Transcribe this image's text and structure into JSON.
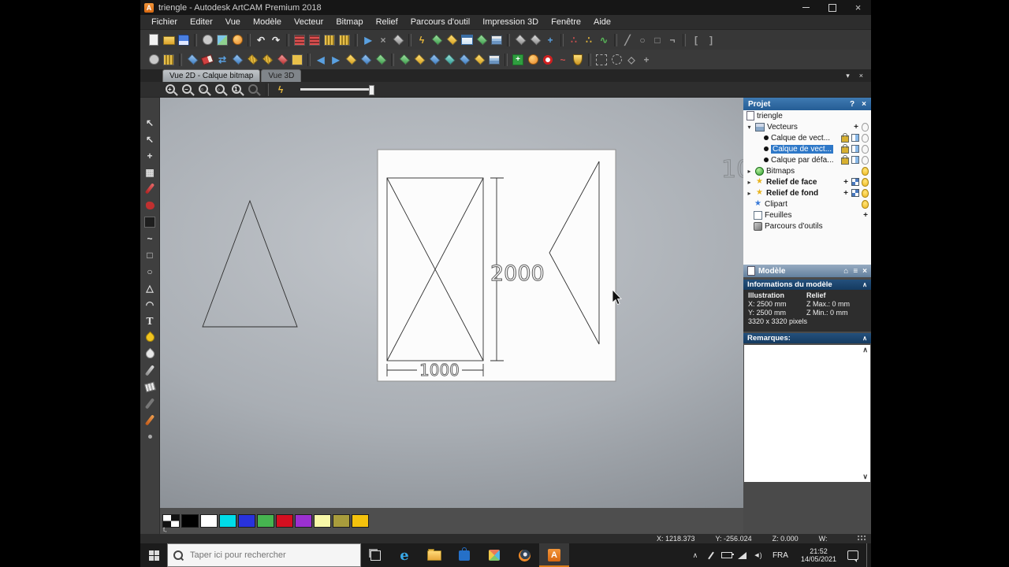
{
  "window": {
    "title": "triengle - Autodesk ArtCAM Premium 2018"
  },
  "menu": {
    "items": [
      "Fichier",
      "Editer",
      "Vue",
      "Modèle",
      "Vecteur",
      "Bitmap",
      "Relief",
      "Parcours d'outil",
      "Impression 3D",
      "Fenêtre",
      "Aide"
    ]
  },
  "tabs": {
    "view2d": "Vue 2D - Calque bitmap",
    "view3d": "Vue 3D"
  },
  "view_controls": {
    "menu": "▾",
    "close": "×"
  },
  "toolbar_main": [
    {
      "name": "new-model-icon",
      "cls": "pg"
    },
    {
      "name": "open-model-icon",
      "cls": "fld"
    },
    {
      "name": "save-model-icon",
      "cls": "flp"
    },
    {
      "sep": true
    },
    {
      "name": "render-preview-icon",
      "cls": "ci gray"
    },
    {
      "name": "bitmap-image-icon",
      "cls": "sq img"
    },
    {
      "name": "face-wizard-icon",
      "cls": "ci orange"
    },
    {
      "sep": true
    },
    {
      "name": "undo-icon",
      "cls": "gl cw",
      "glyph": "↶"
    },
    {
      "name": "redo-icon",
      "cls": "gl cw",
      "glyph": "↷"
    },
    {
      "sep": true
    },
    {
      "name": "guide-film-icon",
      "cls": "sq redstr"
    },
    {
      "name": "guide-film2-icon",
      "cls": "sq redstr"
    },
    {
      "name": "snap-grid-icon",
      "cls": "sq goldstr"
    },
    {
      "name": "snap-guides-icon",
      "cls": "sq goldstr"
    },
    {
      "sep": true
    },
    {
      "name": "vector-select-icon",
      "cls": "gl cbl",
      "glyph": "▶"
    },
    {
      "name": "trim-vectors-icon",
      "cls": "gl cgy",
      "glyph": "×"
    },
    {
      "name": "offset-vector-icon",
      "cls": "di gray"
    },
    {
      "sep": true
    },
    {
      "name": "quick-relief-icon",
      "cls": "gl cgo",
      "glyph": "ϟ"
    },
    {
      "name": "relief-green-icon",
      "cls": "di green"
    },
    {
      "name": "relief-gold-icon",
      "cls": "di gold"
    },
    {
      "name": "preview-window-icon",
      "cls": "win"
    },
    {
      "name": "relief-green2-icon",
      "cls": "di green"
    },
    {
      "name": "relief-layers-icon",
      "cls": "layers"
    },
    {
      "sep": true
    },
    {
      "name": "relief-gray-icon",
      "cls": "di gray"
    },
    {
      "name": "relief-gray2-icon",
      "cls": "di gray"
    },
    {
      "name": "add-relief-icon",
      "cls": "gl cbl",
      "glyph": "+"
    },
    {
      "sep": true
    },
    {
      "name": "node-points-icon",
      "cls": "gl cr",
      "glyph": "∴"
    },
    {
      "name": "node-points2-icon",
      "cls": "gl cgo",
      "glyph": "∴"
    },
    {
      "name": "curve-wave-icon",
      "cls": "gl cgr",
      "glyph": "∿"
    },
    {
      "sep": true
    },
    {
      "name": "measure-line-icon",
      "cls": "gl cgy",
      "glyph": "╱"
    },
    {
      "name": "circle-gray-icon",
      "cls": "gl cgy",
      "glyph": "○"
    },
    {
      "name": "rect-gray-icon",
      "cls": "gl cgy",
      "glyph": "□"
    },
    {
      "name": "corner-gray-icon",
      "cls": "gl cgy",
      "glyph": "¬"
    },
    {
      "sep": true
    },
    {
      "name": "bracket-left-icon",
      "cls": "gl cgy",
      "glyph": "["
    },
    {
      "name": "bracket-right-icon",
      "cls": "gl cgy",
      "glyph": "]"
    }
  ],
  "toolbar_secondary": [
    {
      "name": "snap-circle-icon",
      "cls": "ci gray"
    },
    {
      "name": "snap-grid2-icon",
      "cls": "sq goldstr"
    },
    {
      "sep": true
    },
    {
      "name": "vector-blue-icon",
      "cls": "di blue"
    },
    {
      "name": "eraser-red-icon",
      "cls": "ersr"
    },
    {
      "name": "transform-arrows-icon",
      "cls": "gl cbl",
      "glyph": "⇄"
    },
    {
      "name": "vector-pair-icon",
      "cls": "di blue"
    },
    {
      "name": "hatch-gold-icon",
      "cls": "di goldh"
    },
    {
      "name": "hatch-gold2-icon",
      "cls": "di goldh"
    },
    {
      "name": "vector-red-icon",
      "cls": "di red"
    },
    {
      "name": "swatch-gold-icon",
      "cls": "sq gold"
    },
    {
      "sep": true
    },
    {
      "name": "nudge-left-icon",
      "cls": "gl cbl",
      "glyph": "◀"
    },
    {
      "name": "nudge-right-icon",
      "cls": "gl cbl",
      "glyph": "▶"
    },
    {
      "name": "diamond-gold-icon",
      "cls": "di gold"
    },
    {
      "name": "diamond-blue-icon",
      "cls": "di blue"
    },
    {
      "name": "diamond-green-icon",
      "cls": "di green"
    },
    {
      "sep": true
    },
    {
      "name": "relief-create-icon",
      "cls": "di green"
    },
    {
      "name": "relief-gold2-icon",
      "cls": "di gold"
    },
    {
      "name": "relief-blue-icon",
      "cls": "di blue"
    },
    {
      "name": "relief-teal-icon",
      "cls": "di teal"
    },
    {
      "name": "relief-blue2-icon",
      "cls": "di blue"
    },
    {
      "name": "relief-gold3-icon",
      "cls": "di gold"
    },
    {
      "name": "layers-stack-icon",
      "cls": "layers"
    },
    {
      "sep": true
    },
    {
      "name": "add-green-icon",
      "cls": "grnplus"
    },
    {
      "name": "face-photo-icon",
      "cls": "ci orange"
    },
    {
      "name": "target-icon",
      "cls": "ci redring"
    },
    {
      "name": "wave-red-icon",
      "cls": "gl cr",
      "glyph": "~"
    },
    {
      "name": "shield-gold-icon",
      "cls": "shield"
    },
    {
      "sep": true
    },
    {
      "name": "select-rect-icon",
      "cls": "sq dash"
    },
    {
      "name": "select-ellipse-icon",
      "cls": "ci dash"
    },
    {
      "name": "select-poly-icon",
      "cls": "gl cgy",
      "glyph": "◇"
    },
    {
      "name": "select-pick-icon",
      "cls": "gl cgy",
      "glyph": "+"
    }
  ],
  "zoom_tools": [
    {
      "name": "zoom-in-icon",
      "cls": "mag",
      "glyph": "+"
    },
    {
      "name": "zoom-out-icon",
      "cls": "mag",
      "glyph": "−"
    },
    {
      "name": "zoom-fit-icon",
      "cls": "mag",
      "glyph": "▫"
    },
    {
      "name": "zoom-selection-icon",
      "cls": "mag",
      "glyph": "◦"
    },
    {
      "name": "zoom-100-icon",
      "cls": "mag",
      "glyph": "1"
    },
    {
      "name": "zoom-previous-icon",
      "cls": "mag dim"
    },
    {
      "sep": true
    },
    {
      "name": "snap-lightning-icon",
      "cls": "gl cgo",
      "glyph": "ϟ"
    }
  ],
  "left_tools": [
    {
      "name": "select-tool-icon",
      "cls": "gl cw big",
      "glyph": "↖"
    },
    {
      "name": "node-edit-tool-icon",
      "cls": "gl cgy big",
      "glyph": "↖"
    },
    {
      "name": "transform-tool-icon",
      "cls": "gl cgy big",
      "glyph": "+"
    },
    {
      "name": "grid-tool-icon",
      "cls": "gl cw",
      "glyph": "▦"
    },
    {
      "name": "draw-pencil-tool-icon",
      "cls": "bar red"
    },
    {
      "name": "paint-tool-icon",
      "cls": "blob"
    },
    {
      "name": "flood-fill-tool-icon",
      "cls": "sqd"
    },
    {
      "name": "polyline-tool-icon",
      "cls": "gl cw big",
      "glyph": "~"
    },
    {
      "name": "rectangle-tool-icon",
      "cls": "gl cw big",
      "glyph": "□"
    },
    {
      "name": "circle-tool-icon",
      "cls": "gl cw big",
      "glyph": "○"
    },
    {
      "name": "polygon-tool-icon",
      "cls": "gl cw big",
      "glyph": "△"
    },
    {
      "name": "arc-tool-icon",
      "cls": "gl cw big",
      "glyph": "◠"
    },
    {
      "name": "text-tool-icon",
      "cls": "gl cw serif",
      "glyph": "T"
    },
    {
      "name": "fill-drop-tool-icon",
      "cls": "drop gold"
    },
    {
      "name": "spray-tool-icon",
      "cls": "drop wht"
    },
    {
      "name": "pencil2-tool-icon",
      "cls": "bar gray"
    },
    {
      "name": "eraser-tool-icon",
      "cls": "ers"
    },
    {
      "name": "brush-tool-icon",
      "cls": "bar dark"
    },
    {
      "name": "brush2-tool-icon",
      "cls": "bar orange"
    },
    {
      "name": "smudge-tool-icon",
      "cls": "dotg"
    }
  ],
  "canvas": {
    "dim_vertical": "2000",
    "dim_horizontal": "1000",
    "corner_text": "10"
  },
  "project": {
    "title": "Projet",
    "help_glyph": "?",
    "close_glyph": "×",
    "tree": {
      "items": [
        {
          "label": "triengle"
        },
        {
          "label": "Vecteurs"
        },
        {
          "label": "Calque de vect..."
        },
        {
          "label": "Calque de vect..."
        },
        {
          "label": "Calque par défa..."
        },
        {
          "label": "Bitmaps"
        },
        {
          "label": "Relief de face"
        },
        {
          "label": "Relief de fond"
        },
        {
          "label": "Clipart"
        },
        {
          "label": "Feuilles"
        },
        {
          "label": "Parcours d'outils"
        }
      ]
    }
  },
  "model_bar": {
    "title": "Modèle"
  },
  "model_info": {
    "title": "Informations du modèle",
    "illustration": "Illustration",
    "relief": "Relief",
    "x": "X: 2500 mm",
    "y": "Y: 2500 mm",
    "zmax": "Z Max.: 0 mm",
    "zmin": "Z Min.: 0 mm",
    "pixels": "3320 x 3320 pixels"
  },
  "remarks": {
    "title": "Remarques:"
  },
  "palette": {
    "note": "t,",
    "colors": [
      "#000000",
      "#ffffff",
      "#00dce8",
      "#2832dc",
      "#46b450",
      "#d40f20",
      "#9b30d0",
      "#f8f8a8",
      "#a89c3c",
      "#f4c20d"
    ]
  },
  "statusbar": {
    "x": "X: 1218.373",
    "y": "Y: -256.024",
    "z": "Z: 0.000",
    "w": "W:"
  },
  "taskbar": {
    "search_placeholder": "Taper ici pour rechercher",
    "lang": "FRA",
    "time": "21:52",
    "date": "14/05/2021"
  }
}
